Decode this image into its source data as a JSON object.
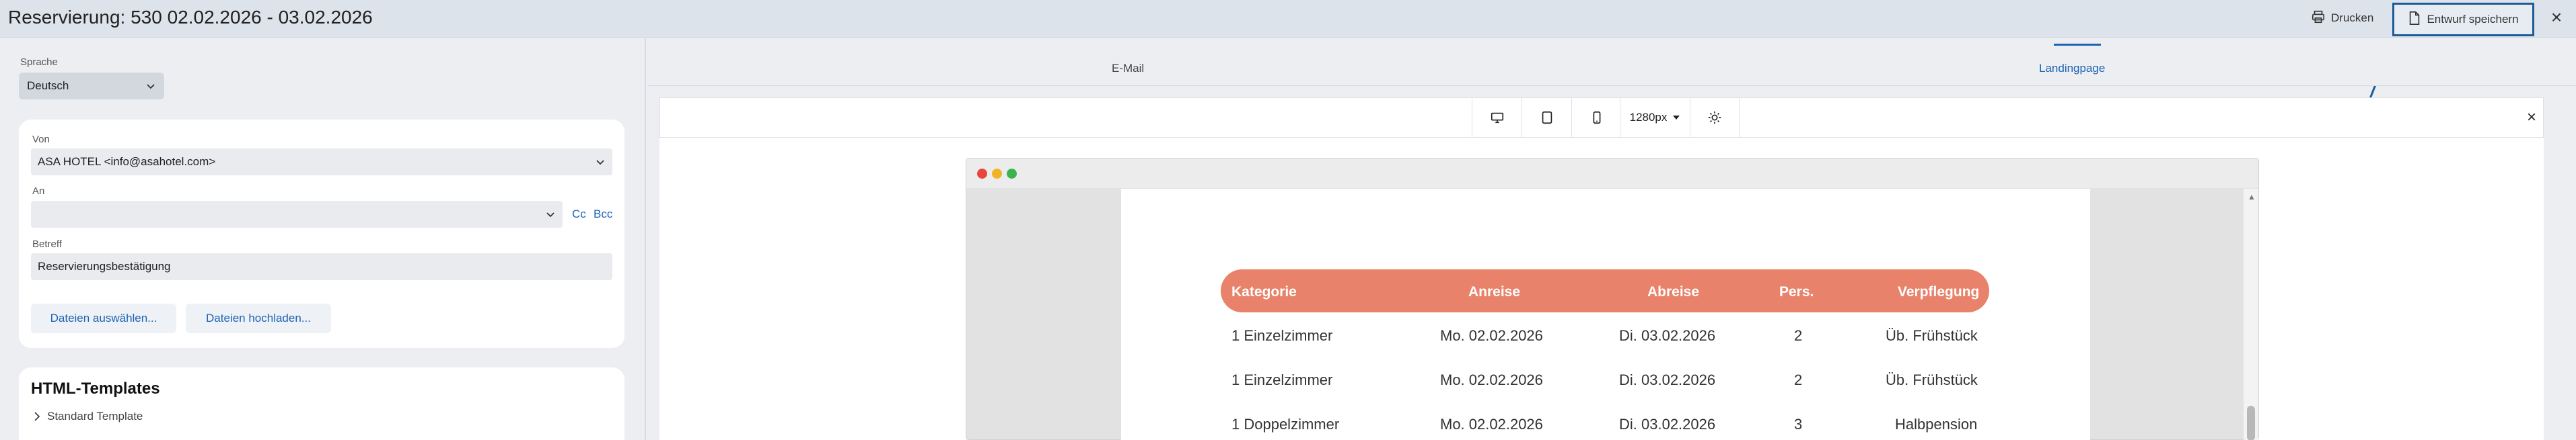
{
  "header": {
    "title": "Reservierung: 530 02.02.2026 - 03.02.2026",
    "print_label": "Drucken",
    "save_draft_label": "Entwurf speichern"
  },
  "form": {
    "language_label": "Sprache",
    "language_value": "Deutsch",
    "from_label": "Von",
    "from_value": "ASA HOTEL <info@asahotel.com>",
    "to_label": "An",
    "to_value": "",
    "cc_label": "Cc",
    "bcc_label": "Bcc",
    "subject_label": "Betreff",
    "subject_value": "Reservierungsbestätigung",
    "select_files_label": "Dateien auswählen...",
    "upload_files_label": "Dateien hochladen..."
  },
  "templates": {
    "title": "HTML-Templates",
    "items": [
      "Standard Template"
    ]
  },
  "tabs": [
    {
      "label": "E-Mail",
      "active": false
    },
    {
      "label": "Landingpage",
      "active": true
    }
  ],
  "preview_toolbar": {
    "devices": [
      "desktop-icon",
      "tablet-icon",
      "mobile-icon"
    ],
    "width_value": "1280px",
    "theme_icon": "sun-icon"
  },
  "reservation_table": {
    "headers": [
      "Kategorie",
      "Anreise",
      "Abreise",
      "Pers.",
      "Verpflegung"
    ],
    "rows": [
      [
        "1 Einzelzimmer",
        "Mo. 02.02.2026",
        "Di. 03.02.2026",
        "2",
        "Üb. Frühstück"
      ],
      [
        "1 Einzelzimmer",
        "Mo. 02.02.2026",
        "Di. 03.02.2026",
        "2",
        "Üb. Frühstück"
      ],
      [
        "1 Doppelzimmer",
        "Mo. 02.02.2026",
        "Di. 03.02.2026",
        "3",
        "Halbpension"
      ]
    ]
  },
  "colors": {
    "accent": "#1a63b5",
    "table_header": "#e9826a",
    "annotation": "#1d5a99"
  }
}
